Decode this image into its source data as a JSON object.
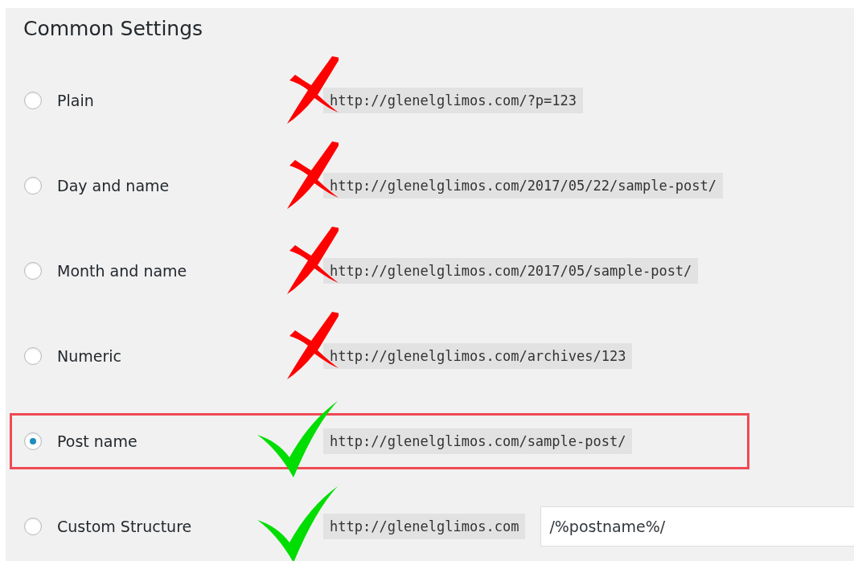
{
  "section_title": "Common Settings",
  "options": [
    {
      "kind": "plain",
      "label": "Plain",
      "selected": false,
      "approved": false,
      "highlighted": false,
      "url": "http://glenelglimos.com/?p=123"
    },
    {
      "kind": "plain",
      "label": "Day and name",
      "selected": false,
      "approved": false,
      "highlighted": false,
      "url": "http://glenelglimos.com/2017/05/22/sample-post/"
    },
    {
      "kind": "plain",
      "label": "Month and name",
      "selected": false,
      "approved": false,
      "highlighted": false,
      "url": "http://glenelglimos.com/2017/05/sample-post/"
    },
    {
      "kind": "plain",
      "label": "Numeric",
      "selected": false,
      "approved": false,
      "highlighted": false,
      "url": "http://glenelglimos.com/archives/123"
    },
    {
      "kind": "plain",
      "label": "Post name",
      "selected": true,
      "approved": true,
      "highlighted": true,
      "url": "http://glenelglimos.com/sample-post/"
    },
    {
      "kind": "custom",
      "label": "Custom Structure",
      "selected": false,
      "approved": true,
      "highlighted": false,
      "url": "http://glenelglimos.com",
      "value": "/%postname%/"
    }
  ]
}
